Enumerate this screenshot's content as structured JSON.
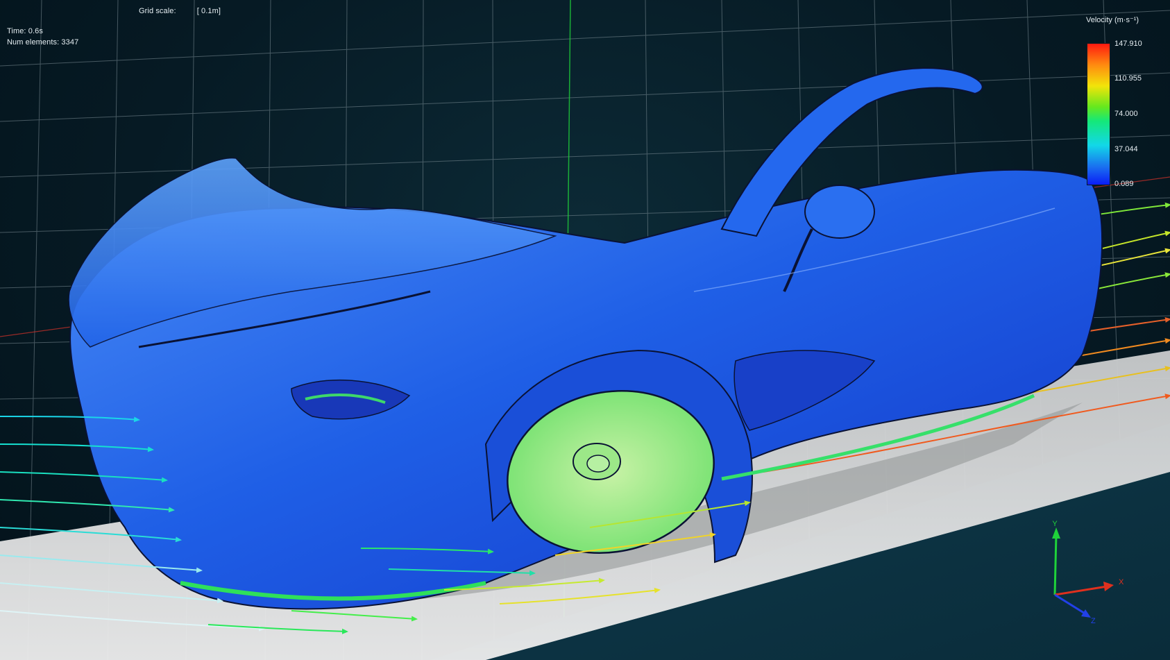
{
  "hud": {
    "time": "Time: 0.6s",
    "elements": "Num elements: 3347",
    "grid_scale_label": "Grid scale:",
    "grid_scale_value": "[ 0.1m]"
  },
  "legend": {
    "title": "Velocity (m·s⁻¹)",
    "ticks": [
      "147.910",
      "110.955",
      "74.000",
      "37.044",
      "0.089"
    ]
  },
  "axes": {
    "x": "X",
    "y": "Y",
    "z": "Z"
  },
  "colors": {
    "car_body": "#1f5fe6",
    "floor": "#d8d8d8",
    "grid": "#7d8e96",
    "axis_x": "#e0301e",
    "axis_y": "#1fd23a",
    "axis_z": "#2240e8"
  }
}
